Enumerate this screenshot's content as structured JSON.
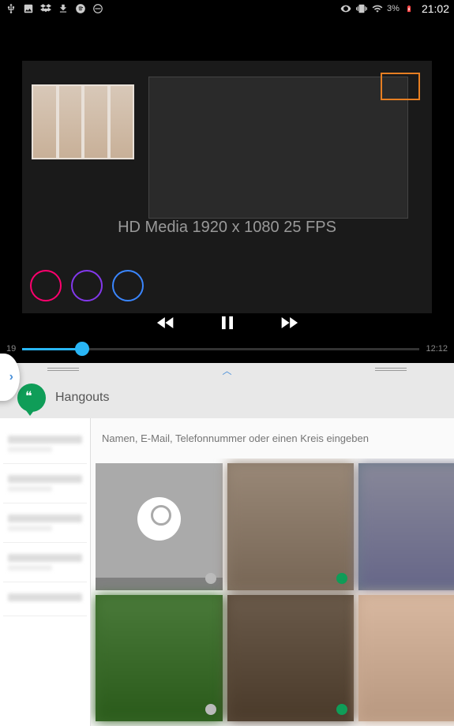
{
  "status_bar": {
    "battery_percent": "3%",
    "time": "21:02"
  },
  "video": {
    "title_overlay": "HD Media 1920 x 1080 25 FPS",
    "elapsed": "19",
    "duration": "12:12"
  },
  "hangouts": {
    "title": "Hangouts",
    "search_placeholder": "Namen, E-Mail, Telefonnummer oder einen Kreis eingeben",
    "sidebar_contacts": [
      {
        "name": "",
        "sub": ""
      },
      {
        "name": "",
        "sub": ""
      },
      {
        "name": "",
        "sub": ""
      },
      {
        "name": "",
        "sub": ""
      },
      {
        "name": "",
        "sub": ""
      }
    ],
    "grid_contacts": [
      {
        "status": "gray",
        "placeholder": true
      },
      {
        "status": "green",
        "bg": "#8a7a6a"
      },
      {
        "status": "green",
        "bg": "#6a7a8a"
      },
      {
        "status": "gray",
        "bg": "#3a6a2a"
      },
      {
        "status": "green",
        "bg": "#5a4a3a"
      },
      {
        "status": "green",
        "bg": "#c8a890"
      }
    ]
  }
}
